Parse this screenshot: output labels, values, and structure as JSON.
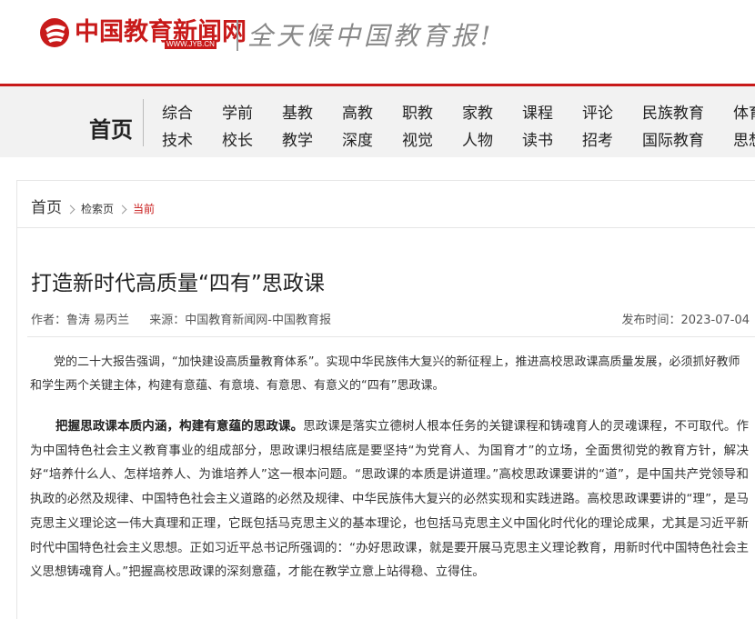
{
  "header": {
    "logo_text": "中国教育新闻网",
    "logo_url": "WWW.JYB.CN",
    "slogan": "全天候中国教育报!"
  },
  "nav": {
    "home": "首页",
    "row1": [
      "综合",
      "学前",
      "基教",
      "高教",
      "职教",
      "家教",
      "课程",
      "评论",
      "民族教育",
      "体育"
    ],
    "row2": [
      "技术",
      "校长",
      "教学",
      "深度",
      "视觉",
      "人物",
      "读书",
      "招考",
      "国际教育",
      "思想"
    ]
  },
  "breadcrumb": {
    "home": "首页",
    "search": "检索页",
    "current": "当前"
  },
  "article": {
    "title": "打造新时代高质量“四有”思政课",
    "author": "作者：鲁涛  易丙兰",
    "source": "来源：中国教育新闻网-中国教育报",
    "date": "发布时间：2023-07-04",
    "para1": "党的二十大报告强调，“加快建设高质量教育体系”。实现中华民族伟大复兴的新征程上，推进高校思政课高质量发展，必须抓好教师和学生两个关键主体，构建有意蕴、有意境、有意思、有意义的“四有”思政课。",
    "para2_bold": "把握思政课本质内涵，构建有意蕴的思政课。",
    "para2_text": "思政课是落实立德树人根本任务的关键课程和铸魂育人的灵魂课程，不可取代。作为中国特色社会主义教育事业的组成部分，思政课归根结底是要坚持“为党育人、为国育才”的立场，全面贯彻党的教育方针，解决好“培养什么人、怎样培养人、为谁培养人”这一根本问题。“思政课的本质是讲道理。”高校思政课要讲的“道”，是中国共产党领导和执政的必然及规律、中国特色社会主义道路的必然及规律、中华民族伟大复兴的必然实现和实践进路。高校思政课要讲的“理”，是马克思主义理论这一伟大真理和正理，它既包括马克思主义的基本理论，也包括马克思主义中国化时代化的理论成果，尤其是习近平新时代中国特色社会主义思想。正如习近平总书记所强调的：“办好思政课，就是要开展马克思主义理论教育，用新时代中国特色社会主义思想铸魂育人。”把握高校思政课的深刻意蕴，才能在教学立意上站得稳、立得住。"
  },
  "colors": {
    "brand_red": "#c81a1a"
  }
}
